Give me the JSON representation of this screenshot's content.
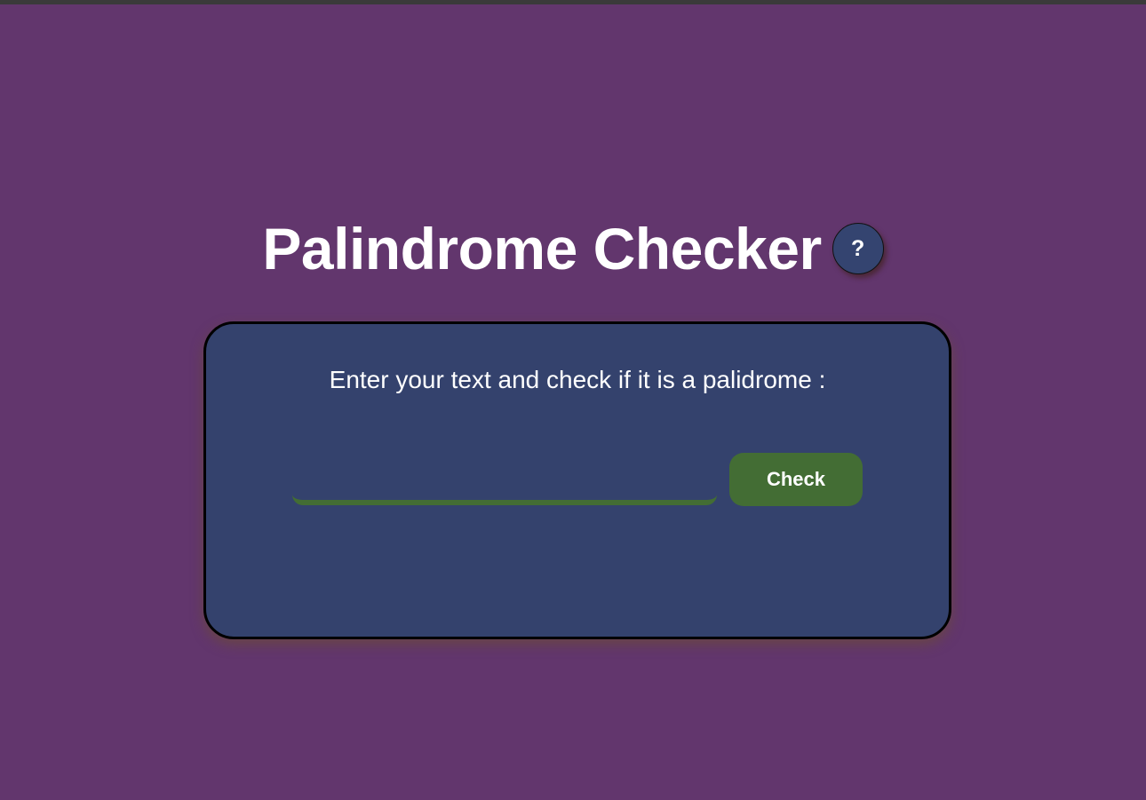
{
  "header": {
    "title": "Palindrome Checker",
    "help_label": "?"
  },
  "card": {
    "prompt": "Enter your text and check if it is a palidrome :",
    "input_value": "",
    "check_label": "Check"
  },
  "colors": {
    "background": "#62366d",
    "card": "#34426d",
    "accent": "#436d34",
    "text": "#ffffff"
  }
}
